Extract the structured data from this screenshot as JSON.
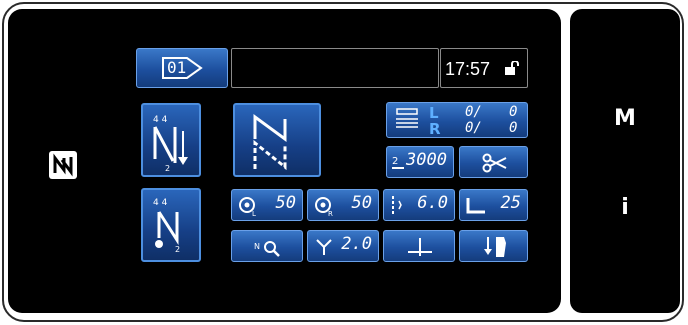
{
  "side": {
    "menu_label": "M",
    "info_label": "i"
  },
  "top": {
    "pattern_no": "01",
    "time": "17:57"
  },
  "thread": {
    "left_label": "L",
    "left_value": "0/",
    "left_value2": "0",
    "right_label": "R",
    "right_value": "0/",
    "right_value2": "0"
  },
  "counter": {
    "value": "3000"
  },
  "tension": {
    "left": "50",
    "right": "50"
  },
  "stitch": {
    "pitch": "6.0",
    "count": "25",
    "width": "2.0"
  },
  "icons": {
    "nfc": "nfc-icon",
    "lock": "unlock-icon",
    "scissors": "scissors-icon",
    "pattern": "pattern-number-icon"
  },
  "colors": {
    "button": "#1d4f9e",
    "button_border": "#6aa0e8",
    "screen": "#000000",
    "accent": "#5fb0ff"
  }
}
